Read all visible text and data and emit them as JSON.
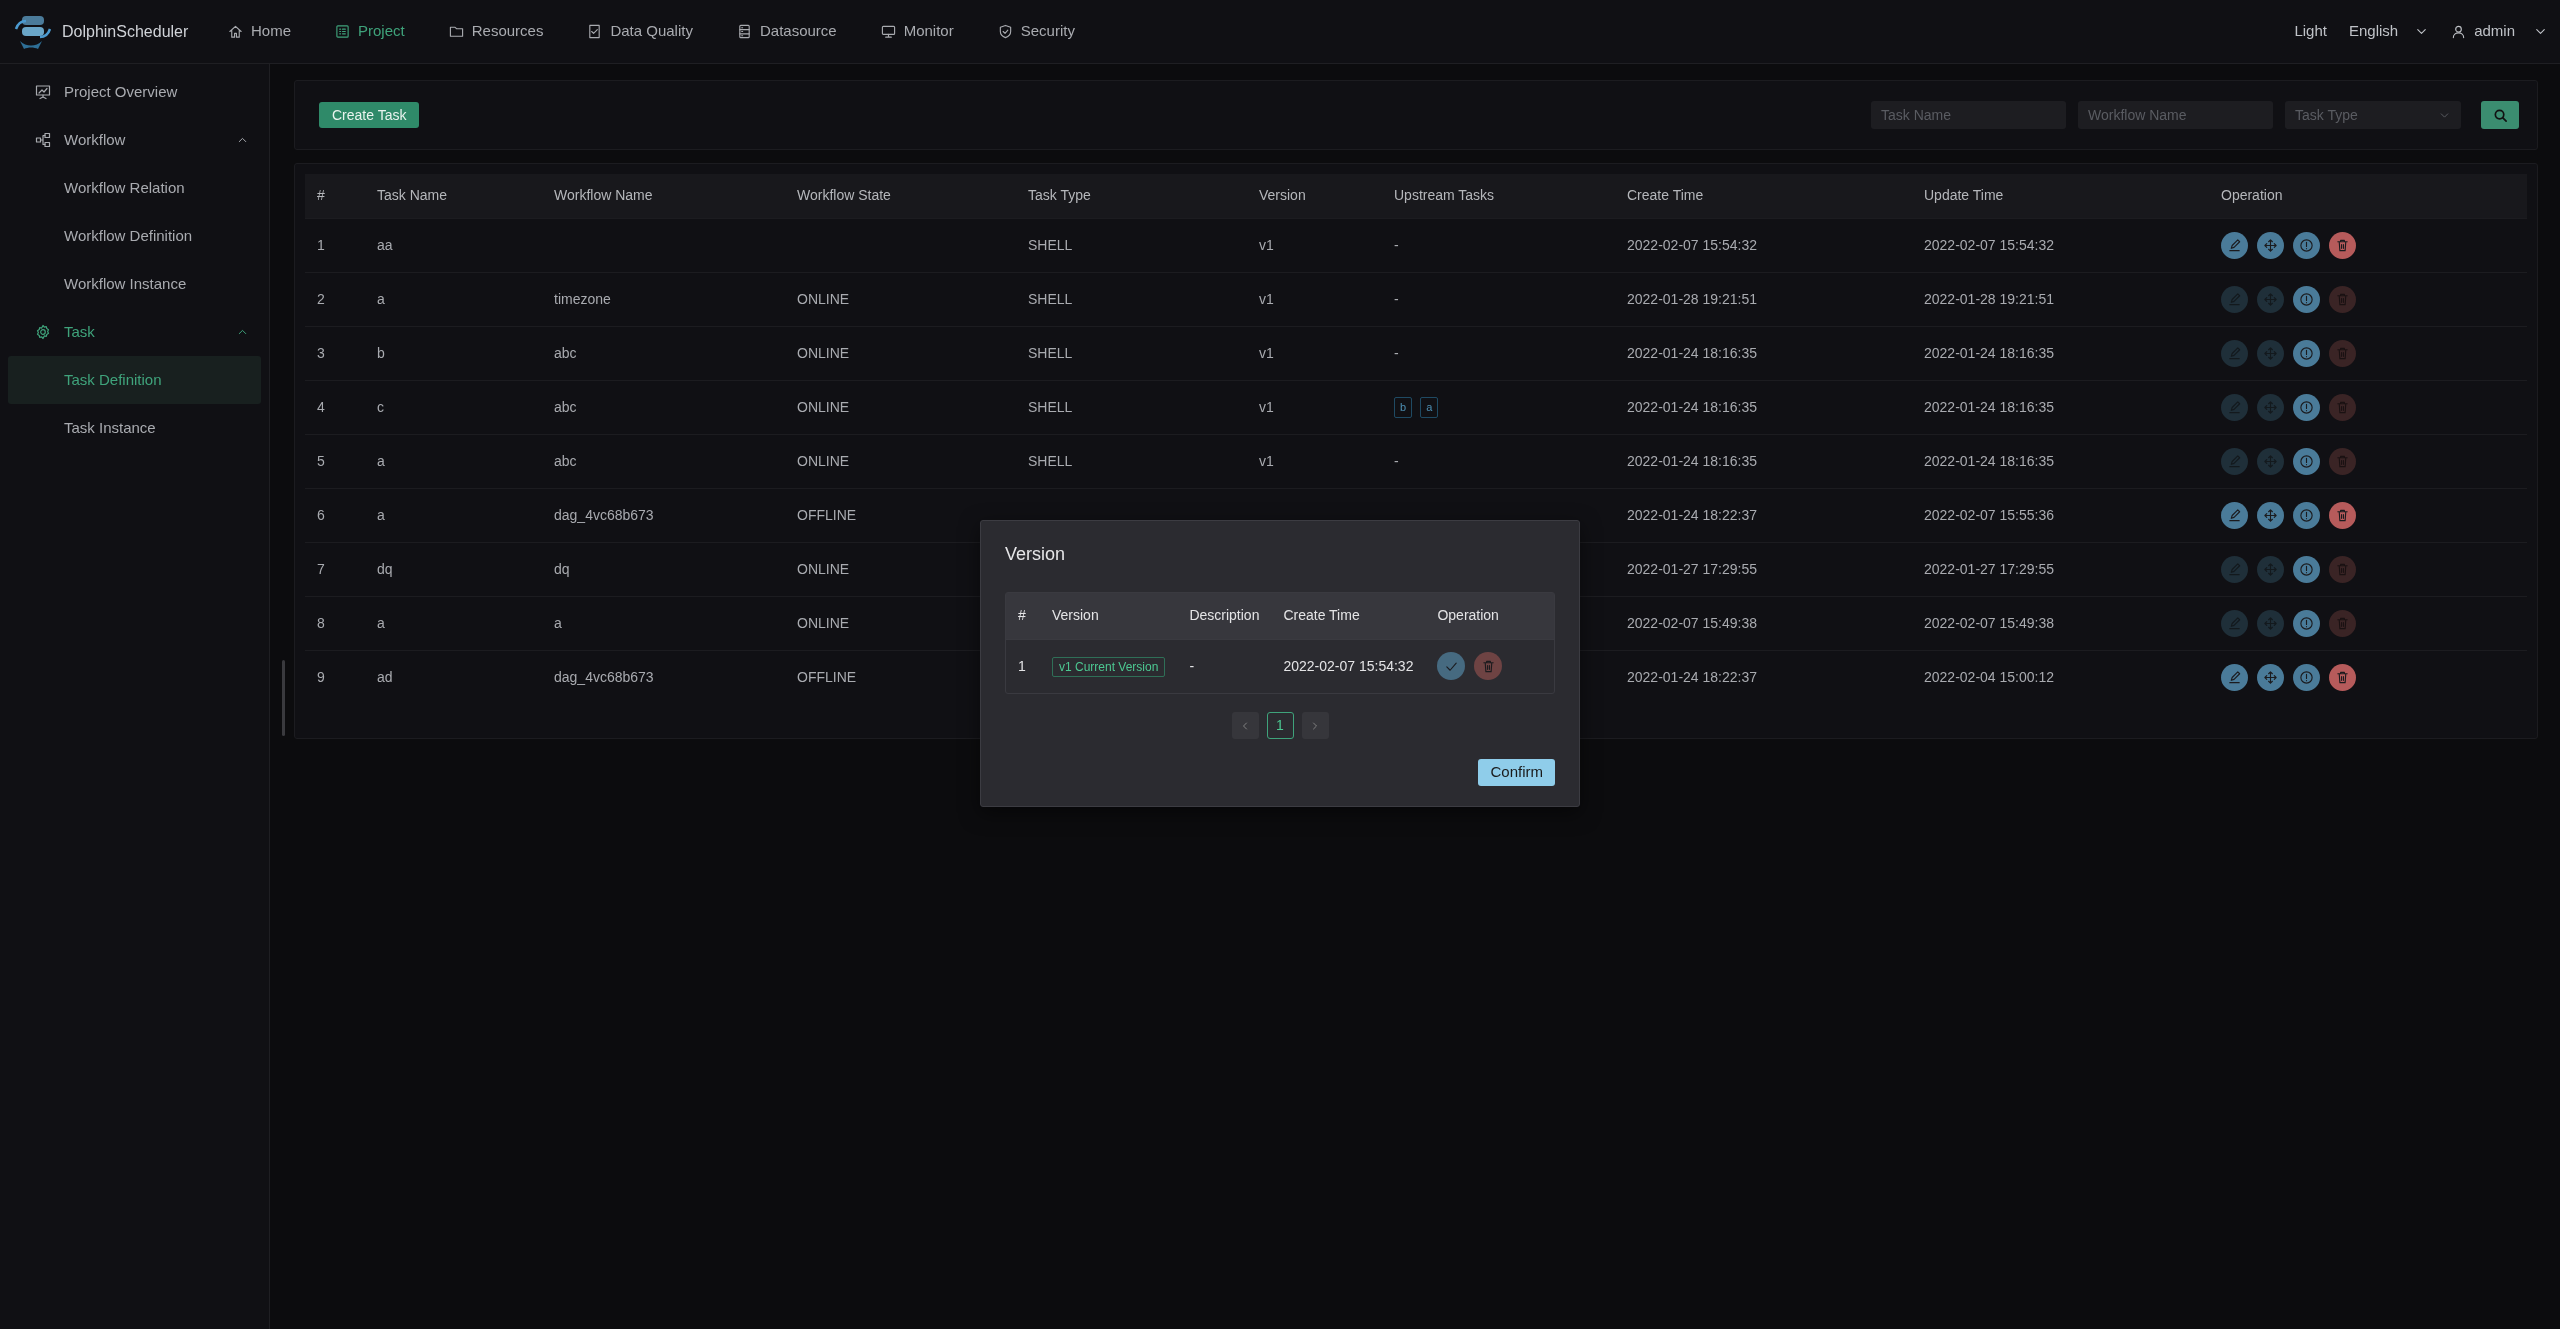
{
  "app": {
    "name": "DolphinScheduler"
  },
  "nav": [
    {
      "label": "Home",
      "selected": false
    },
    {
      "label": "Project",
      "selected": true
    },
    {
      "label": "Resources",
      "selected": false
    },
    {
      "label": "Data Quality",
      "selected": false
    },
    {
      "label": "Datasource",
      "selected": false
    },
    {
      "label": "Monitor",
      "selected": false
    },
    {
      "label": "Security",
      "selected": false
    }
  ],
  "header_right": {
    "theme_toggle": "Light",
    "language": "English",
    "user": "admin"
  },
  "sidebar": {
    "items": [
      {
        "label": "Project Overview",
        "selected": false
      },
      {
        "label": "Workflow",
        "selected": false,
        "expanded": true,
        "children": [
          {
            "label": "Workflow Relation",
            "selected": false
          },
          {
            "label": "Workflow Definition",
            "selected": false
          },
          {
            "label": "Workflow Instance",
            "selected": false
          }
        ]
      },
      {
        "label": "Task",
        "selected": true,
        "expanded": true,
        "children": [
          {
            "label": "Task Definition",
            "selected": true
          },
          {
            "label": "Task Instance",
            "selected": false
          }
        ]
      }
    ]
  },
  "toolbar": {
    "create_button": "Create Task",
    "filters": [
      {
        "kind": "text",
        "placeholder": "Task Name"
      },
      {
        "kind": "text",
        "placeholder": "Workflow Name"
      },
      {
        "kind": "select",
        "placeholder": "Task Type"
      }
    ]
  },
  "table": {
    "columns": [
      "#",
      "Task Name",
      "Workflow Name",
      "Workflow State",
      "Task Type",
      "Version",
      "Upstream Tasks",
      "Create Time",
      "Update Time",
      "Operation"
    ],
    "rows": [
      {
        "index": "1",
        "task_name": "aa",
        "task_type": "SHELL",
        "version": "v1",
        "upstream": "-",
        "create_time": "2022-02-07 15:54:32",
        "update_time": "2022-02-07 15:54:32",
        "enabled": true
      },
      {
        "index": "2",
        "task_name": "a",
        "workflow_name": "timezone",
        "workflow_state": "ONLINE",
        "task_type": "SHELL",
        "version": "v1",
        "upstream": "-",
        "create_time": "2022-01-28 19:21:51",
        "update_time": "2022-01-28 19:21:51",
        "enabled": false
      },
      {
        "index": "3",
        "task_name": "b",
        "workflow_name": "abc",
        "workflow_state": "ONLINE",
        "task_type": "SHELL",
        "version": "v1",
        "upstream": "-",
        "create_time": "2022-01-24 18:16:35",
        "update_time": "2022-01-24 18:16:35",
        "enabled": false
      },
      {
        "index": "4",
        "task_name": "c",
        "workflow_name": "abc",
        "workflow_state": "ONLINE",
        "task_type": "SHELL",
        "version": "v1",
        "upstream_tags": [
          "b",
          "a"
        ],
        "create_time": "2022-01-24 18:16:35",
        "update_time": "2022-01-24 18:16:35",
        "enabled": false
      },
      {
        "index": "5",
        "task_name": "a",
        "workflow_name": "abc",
        "workflow_state": "ONLINE",
        "task_type": "SHELL",
        "version": "v1",
        "upstream": "-",
        "create_time": "2022-01-24 18:16:35",
        "update_time": "2022-01-24 18:16:35",
        "enabled": false
      },
      {
        "index": "6",
        "task_name": "a",
        "workflow_name": "dag_4vc68b673",
        "workflow_state": "OFFLINE",
        "create_time": "2022-01-24 18:22:37",
        "update_time": "2022-02-07 15:55:36",
        "enabled": true
      },
      {
        "index": "7",
        "task_name": "dq",
        "workflow_name": "dq",
        "workflow_state": "ONLINE",
        "create_time": "2022-01-27 17:29:55",
        "update_time": "2022-01-27 17:29:55",
        "enabled": false
      },
      {
        "index": "8",
        "task_name": "a",
        "workflow_name": "a",
        "workflow_state": "ONLINE",
        "create_time": "2022-02-07 15:49:38",
        "update_time": "2022-02-07 15:49:38",
        "enabled": false
      },
      {
        "index": "9",
        "task_name": "ad",
        "workflow_name": "dag_4vc68b673",
        "workflow_state": "OFFLINE",
        "create_time": "2022-01-24 18:22:37",
        "update_time": "2022-02-04 15:00:12",
        "enabled": true
      }
    ]
  },
  "modal": {
    "title": "Version",
    "columns": [
      "#",
      "Version",
      "Description",
      "Create Time",
      "Operation"
    ],
    "rows": [
      {
        "index": "1",
        "version": "v1 Current Version",
        "description": "-",
        "create_time": "2022-02-07 15:54:32"
      }
    ],
    "pages": [
      {
        "label": "1",
        "selected": true
      }
    ],
    "confirm": "Confirm"
  }
}
